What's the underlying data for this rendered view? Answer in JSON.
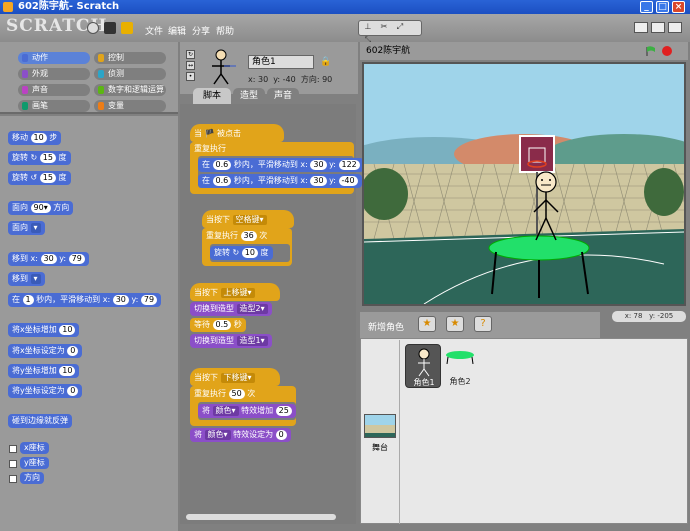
{
  "window": {
    "title": "602陈宇航- Scratch",
    "controls": [
      "minimize-icon",
      "maximize-icon",
      "close-icon"
    ]
  },
  "menubar": {
    "logo": "SCRATCH",
    "icons": [
      "globe-icon",
      "save-icon",
      "share-icon"
    ],
    "items": [
      "文件",
      "编辑",
      "分享",
      "帮助"
    ]
  },
  "categories": [
    {
      "label": "动作",
      "color": "#4a6cd4",
      "selected": true
    },
    {
      "label": "控制",
      "color": "#e1a41a"
    },
    {
      "label": "外观",
      "color": "#8b4fc8"
    },
    {
      "label": "侦测",
      "color": "#2ca5c8"
    },
    {
      "label": "声音",
      "color": "#bb42c3"
    },
    {
      "label": "数字和逻辑运算",
      "color": "#5cb712"
    },
    {
      "label": "画笔",
      "color": "#0e9a6c"
    },
    {
      "label": "变量",
      "color": "#ee7d16"
    }
  ],
  "palette": {
    "move": {
      "pre": "移动",
      "val": "10",
      "post": "步"
    },
    "turn_cw": {
      "pre": "旋转",
      "val": "15",
      "post": "度"
    },
    "turn_ccw": {
      "pre": "旋转",
      "val": "15",
      "post": "度"
    },
    "point_dir": {
      "pre": "面向",
      "val": "90▾",
      "post": "方向"
    },
    "point_towards": {
      "pre": "面向"
    },
    "goto_xy": {
      "pre": "移到 x:",
      "x": "30",
      "mid": "y:",
      "y": "79"
    },
    "goto": {
      "pre": "移到"
    },
    "glide": {
      "pre": "在",
      "secs": "1",
      "mid": "秒内，平滑移动到 x:",
      "x": "30",
      "mid2": "y:",
      "y": "79"
    },
    "change_x": {
      "pre": "将x坐标增加",
      "val": "10"
    },
    "set_x": {
      "pre": "将x坐标设定为",
      "val": "0"
    },
    "change_y": {
      "pre": "将y坐标增加",
      "val": "10"
    },
    "set_y": {
      "pre": "将y坐标设定为",
      "val": "0"
    },
    "bounce": "碰到边缘就反弹",
    "rep_x": "x座标",
    "rep_y": "y座标",
    "rep_dir": "方向"
  },
  "sprite": {
    "name": "角色1",
    "x_label": "x:",
    "x": "30",
    "y_label": "y:",
    "y": "-40",
    "dir_label": "方向:",
    "dir": "90"
  },
  "tabs": [
    "脚本",
    "造型",
    "声音"
  ],
  "scripts": {
    "s1_hat": "当 🏴 被点击",
    "s1_forever": "重复执行",
    "s1_glide1": {
      "pre": "在",
      "secs": "0.6",
      "mid": "秒内，平滑移动到 x:",
      "x": "30",
      "mid2": "y:",
      "y": "122"
    },
    "s1_glide2": {
      "pre": "在",
      "secs": "0.6",
      "mid": "秒内，平滑移动到 x:",
      "x": "30",
      "mid2": "y:",
      "y": "-40"
    },
    "s2_hat": {
      "pre": "当按下",
      "key": "空格键▾"
    },
    "s2_repeat": {
      "pre": "重复执行",
      "val": "36",
      "post": "次"
    },
    "s2_turn": {
      "pre": "旋转",
      "val": "10",
      "post": "度"
    },
    "s3_hat": {
      "pre": "当按下",
      "key": "上移键▾"
    },
    "s3_switch1": {
      "pre": "切换到造型",
      "val": "造型2▾"
    },
    "s3_wait": {
      "pre": "等待",
      "val": "0.5",
      "post": "秒"
    },
    "s3_switch2": {
      "pre": "切换到造型",
      "val": "造型1▾"
    },
    "s4_hat": {
      "pre": "当按下",
      "key": "下移键▾"
    },
    "s4_repeat": {
      "pre": "重复执行",
      "val": "50",
      "post": "次"
    },
    "s4_change": {
      "pre": "将",
      "eff": "颜色▾",
      "mid": "特效增加",
      "val": "25"
    },
    "s4_set": {
      "pre": "将",
      "eff": "颜色▾",
      "mid": "特效设定为",
      "val": "0"
    }
  },
  "stage": {
    "title": "602陈宇航",
    "coords": {
      "x_label": "x:",
      "x": "78",
      "y_label": "y:",
      "y": "-205"
    }
  },
  "sprite_list": {
    "new_sprite_label": "新增角色",
    "items": [
      {
        "name": "角色1",
        "selected": true
      },
      {
        "name": "角色2"
      }
    ],
    "stage_label": "舞台"
  }
}
